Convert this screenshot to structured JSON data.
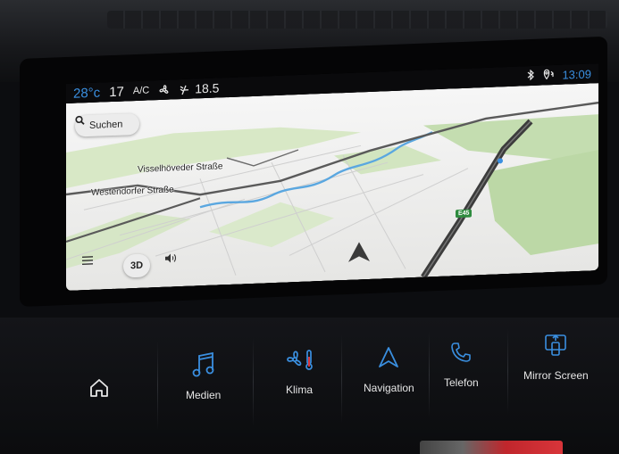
{
  "statusbar": {
    "temperature": "28°c",
    "fan_level": "17",
    "ac_label": "A/C",
    "seat_temp": "18.5",
    "clock": "13:09",
    "icons": [
      "fan-icon",
      "seat-airflow-icon",
      "bluetooth-icon",
      "location-sync-icon"
    ]
  },
  "map": {
    "search_label": "Suchen",
    "view_mode_label": "3D",
    "roads": [
      {
        "name": "Visselhöveder Straße"
      },
      {
        "name": "Westendorfer Straße"
      }
    ],
    "highway_shield": "E45",
    "colors": {
      "land": "#e9e9e7",
      "greenery": "#c4ddb0",
      "water": "#5aa7e0",
      "road_main": "#5a5a5a",
      "sky": "#f3f3f3"
    }
  },
  "touchbar": {
    "items": [
      {
        "label": "",
        "icon": "home-icon"
      },
      {
        "label": "Medien",
        "icon": "music-note-icon"
      },
      {
        "label": "Klima",
        "icon": "climate-fan-icon"
      },
      {
        "label": "Navigation",
        "icon": "navigation-arrow-icon"
      },
      {
        "label": "Telefon",
        "icon": "phone-icon"
      },
      {
        "label": "Mirror Screen",
        "icon": "mirror-screen-icon"
      }
    ],
    "accent": "#3a8fe0"
  }
}
